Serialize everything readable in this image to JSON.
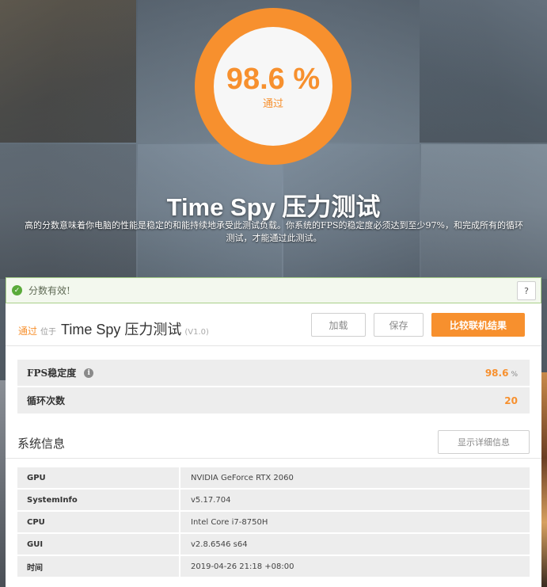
{
  "score": {
    "value": "98.6 %",
    "status": "通过"
  },
  "hero": {
    "title": "Time Spy 压力测试",
    "description": "高的分数意味着你电脑的性能是稳定的和能持续地承受此测试负载。你系统的FPS的稳定度必须达到至少97%，和完成所有的循环测试，才能通过此测试。"
  },
  "banner": {
    "text": "分数有效!",
    "help_label": "?"
  },
  "result": {
    "status": "通过",
    "located": "位于",
    "test_name": "Time Spy 压力测试",
    "version": "(V1.0)"
  },
  "buttons": {
    "load": "加载",
    "save": "保存",
    "compare": "比较联机结果",
    "details": "显示详细信息"
  },
  "metrics": {
    "fps_label": "FPS稳定度",
    "fps_value": "98.6",
    "fps_unit": "%",
    "loops_label": "循环次数",
    "loops_value": "20"
  },
  "system": {
    "title": "系统信息",
    "rows": [
      {
        "key": "GPU",
        "value": "NVIDIA GeForce RTX 2060"
      },
      {
        "key": "SystemInfo",
        "value": "v5.17.704"
      },
      {
        "key": "CPU",
        "value": "Intel Core i7-8750H"
      },
      {
        "key": "GUI",
        "value": "v2.8.6546 s64"
      },
      {
        "key": "时间",
        "value": "2019-04-26 21:18 +08:00"
      }
    ]
  },
  "colors": {
    "accent": "#f7902e",
    "valid_green": "#5aaa3a"
  }
}
